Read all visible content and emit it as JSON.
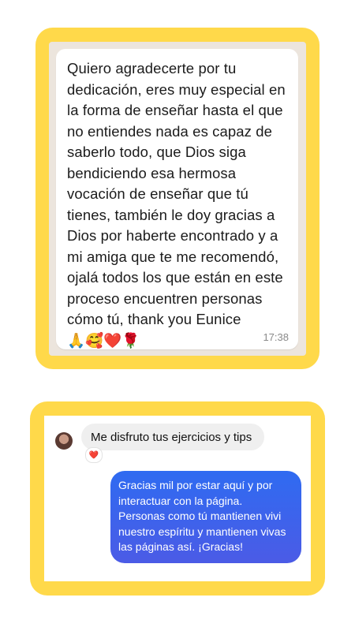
{
  "whatsapp": {
    "message": "Quiero agradecerte por tu dedicación, eres muy especial en la forma de enseñar hasta el que no entiendes nada es capaz de saberlo todo, que Dios siga bendiciendo esa hermosa vocación de enseñar que tú tienes, también le doy gracias a Dios por haberte encontrado y a mi amiga que te me recomendó, ojalá todos los que están en este proceso encuentren personas cómo tú, thank you Eunice",
    "emojis": "🙏🥰❤️🌹",
    "time": "17:38"
  },
  "instagram": {
    "incoming_message": "Me disfruto tus ejercicios y tips",
    "reaction": "❤️",
    "outgoing_message": "Gracias mil por estar aquí y por interactuar con la página. Personas como tú mantienen vivi nuestro espíritu y mantienen vivas las páginas así. ¡Gracias!"
  },
  "colors": {
    "frame": "#FFD94A",
    "chat_background": "#ECE5DD",
    "outgoing_bubble": "#3A64EC",
    "incoming_bubble": "#EFEFEF"
  }
}
